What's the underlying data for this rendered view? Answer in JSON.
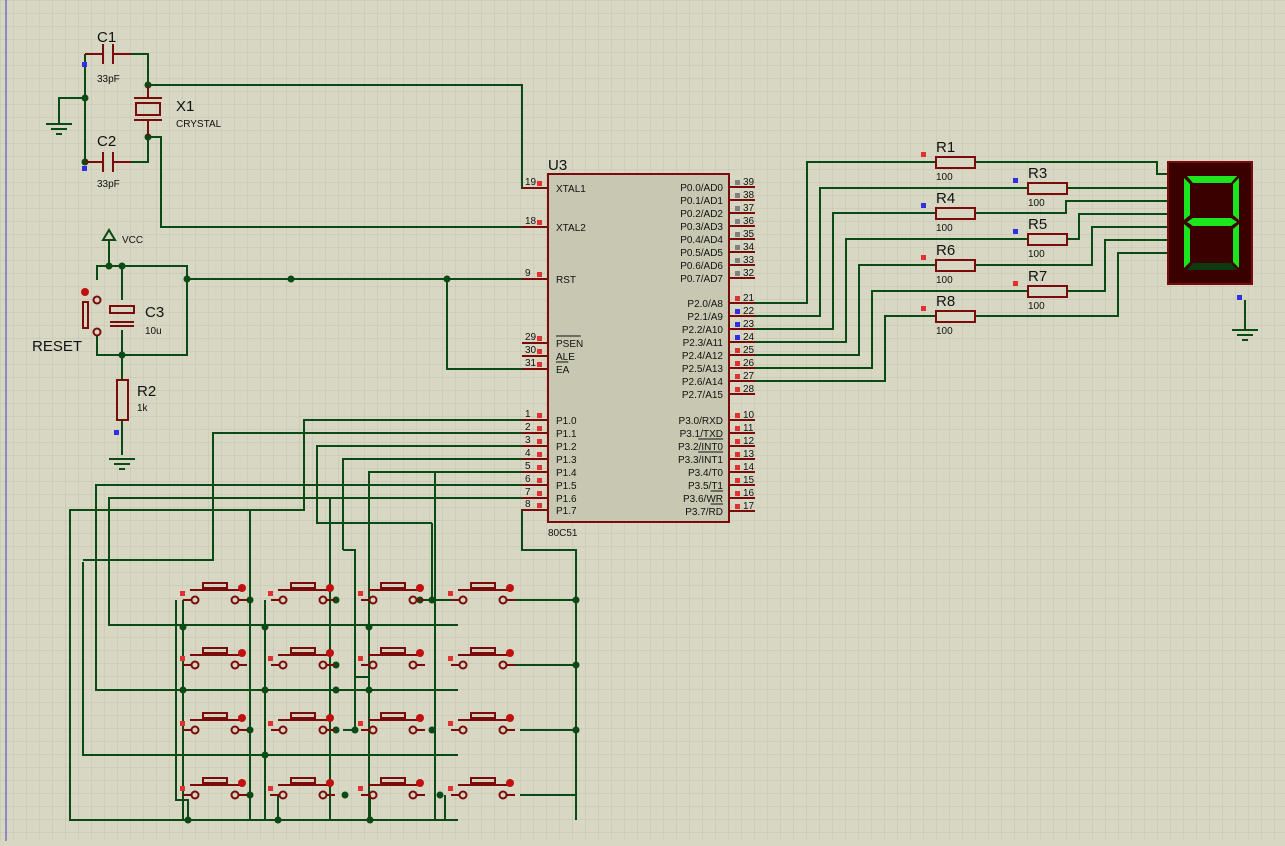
{
  "components": {
    "c1": {
      "ref": "C1",
      "value": "33pF"
    },
    "c2": {
      "ref": "C2",
      "value": "33pF"
    },
    "x1": {
      "ref": "X1",
      "value": "CRYSTAL"
    },
    "c3": {
      "ref": "C3",
      "value": "10u"
    },
    "r2": {
      "ref": "R2",
      "value": "1k"
    },
    "vcc": "VCC",
    "reset": "RESET",
    "u3": {
      "ref": "U3",
      "part": "80C51"
    },
    "resistors": [
      {
        "ref": "R1",
        "value": "100"
      },
      {
        "ref": "R3",
        "value": "100"
      },
      {
        "ref": "R4",
        "value": "100"
      },
      {
        "ref": "R5",
        "value": "100"
      },
      {
        "ref": "R6",
        "value": "100"
      },
      {
        "ref": "R7",
        "value": "100"
      },
      {
        "ref": "R8",
        "value": "100"
      }
    ]
  },
  "mcu_left_pins": [
    {
      "num": "19",
      "name": "XTAL1"
    },
    {
      "num": "18",
      "name": "XTAL2"
    },
    {
      "num": "9",
      "name": "RST"
    },
    {
      "num": "29",
      "name": "PSEN"
    },
    {
      "num": "30",
      "name": "ALE"
    },
    {
      "num": "31",
      "name": "EA"
    },
    {
      "num": "1",
      "name": "P1.0"
    },
    {
      "num": "2",
      "name": "P1.1"
    },
    {
      "num": "3",
      "name": "P1.2"
    },
    {
      "num": "4",
      "name": "P1.3"
    },
    {
      "num": "5",
      "name": "P1.4"
    },
    {
      "num": "6",
      "name": "P1.5"
    },
    {
      "num": "7",
      "name": "P1.6"
    },
    {
      "num": "8",
      "name": "P1.7"
    }
  ],
  "mcu_right_pins": [
    {
      "num": "39",
      "name": "P0.0/AD0"
    },
    {
      "num": "38",
      "name": "P0.1/AD1"
    },
    {
      "num": "37",
      "name": "P0.2/AD2"
    },
    {
      "num": "36",
      "name": "P0.3/AD3"
    },
    {
      "num": "35",
      "name": "P0.4/AD4"
    },
    {
      "num": "34",
      "name": "P0.5/AD5"
    },
    {
      "num": "33",
      "name": "P0.6/AD6"
    },
    {
      "num": "32",
      "name": "P0.7/AD7"
    },
    {
      "num": "21",
      "name": "P2.0/A8"
    },
    {
      "num": "22",
      "name": "P2.1/A9"
    },
    {
      "num": "23",
      "name": "P2.2/A10"
    },
    {
      "num": "24",
      "name": "P2.3/A11"
    },
    {
      "num": "25",
      "name": "P2.4/A12"
    },
    {
      "num": "26",
      "name": "P2.5/A13"
    },
    {
      "num": "27",
      "name": "P2.6/A14"
    },
    {
      "num": "28",
      "name": "P2.7/A15"
    },
    {
      "num": "10",
      "name": "P3.0/RXD"
    },
    {
      "num": "11",
      "name": "P3.1/TXD"
    },
    {
      "num": "12",
      "name": "P3.2/INT0"
    },
    {
      "num": "13",
      "name": "P3.3/INT1"
    },
    {
      "num": "14",
      "name": "P3.4/T0"
    },
    {
      "num": "15",
      "name": "P3.5/T1"
    },
    {
      "num": "16",
      "name": "P3.6/WR"
    },
    {
      "num": "17",
      "name": "P3.7/RD"
    }
  ],
  "colors": {
    "background": "#d7d7c4",
    "grid": "#c3c3b0",
    "wire": "#0a4a14",
    "component": "#7a0b0b",
    "chip_fill": "#c8c8b2",
    "display_bg": "#3a0000",
    "segment_on": "#1de51d",
    "segment_off": "#0f3a0f",
    "pin_red": "#e03030",
    "pin_blue": "#3030e0"
  },
  "seven_segment": {
    "lit_segments": [
      "a",
      "b",
      "f",
      "g",
      "e",
      "c"
    ]
  }
}
